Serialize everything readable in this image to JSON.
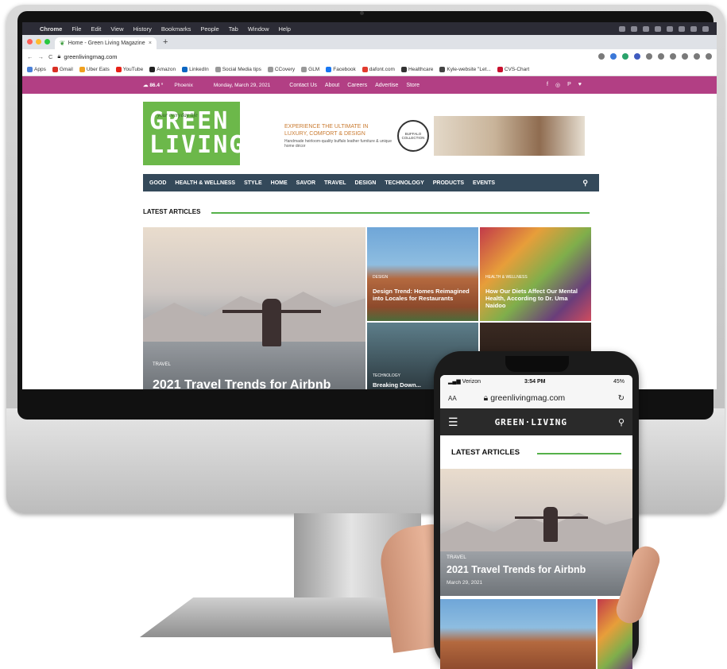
{
  "macos": {
    "apple": "",
    "app": "Chrome",
    "menus": [
      "File",
      "Edit",
      "View",
      "History",
      "Bookmarks",
      "People",
      "Tab",
      "Window",
      "Help"
    ]
  },
  "browser": {
    "tab_title": "Home - Green Living Magazine",
    "tab_close": "×",
    "new_tab": "+",
    "url": "greenlivingmag.com",
    "bookmarks": [
      "Apps",
      "Gmail",
      "Uber Eats",
      "YouTube",
      "Amazon",
      "LinkedIn",
      "Social Media tips",
      "CCovery",
      "GLM",
      "Facebook",
      "dafont.com",
      "Healthcare",
      "Kyle-website \"Let...",
      "CVS-Chart"
    ]
  },
  "site": {
    "weather_temp": "86.4 °",
    "weather_city": "Phoenix",
    "date": "Monday, March 29, 2021",
    "top_links": [
      "Contact Us",
      "About",
      "Careers",
      "Advertise",
      "Store"
    ],
    "social": [
      "f",
      "◎",
      "P",
      "♥"
    ],
    "logo_tagline": "your everyday life",
    "logo_line1": "GREEN",
    "logo_line2": "LIVING",
    "ad_headline": "EXPERIENCE THE ULTIMATE IN LUXURY, COMFORT & DESIGN",
    "ad_sub": "Handmade heirloom-quality buffalo leather furniture & unique home décor",
    "ad_seal": "BUFFALO COLLECTION",
    "nav": [
      "GOOD",
      "HEALTH & WELLNESS",
      "STYLE",
      "HOME",
      "SAVOR",
      "TRAVEL",
      "DESIGN",
      "TECHNOLOGY",
      "PRODUCTS",
      "EVENTS"
    ],
    "section_title": "LATEST ARTICLES",
    "hero_category": "TRAVEL",
    "hero_title": "2021 Travel Trends for Airbnb",
    "cards": [
      {
        "category": "DESIGN",
        "title": "Design Trend: Homes Reimagined into Locales for Restaurants"
      },
      {
        "category": "HEALTH & WELLNESS",
        "title": "How Our Diets Affect Our Mental Health, According to Dr. Uma Naidoo"
      },
      {
        "category": "TECHNOLOGY",
        "title": "Breaking Down..."
      }
    ]
  },
  "phone": {
    "carrier": "Verizon",
    "time": "3:54 PM",
    "battery": "45%",
    "aa": "AA",
    "url": "greenlivingmag.com",
    "logo": "GREEN·LIVING",
    "section_title": "LATEST ARTICLES",
    "hero_category": "TRAVEL",
    "hero_title": "2021 Travel Trends for Airbnb",
    "hero_date": "March 29, 2021"
  }
}
